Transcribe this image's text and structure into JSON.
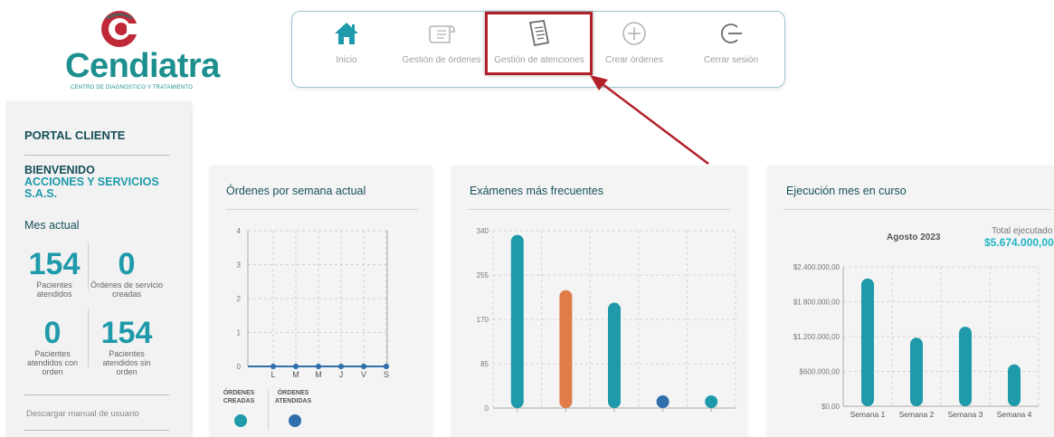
{
  "logo": {
    "name": "Cendiatra",
    "subtitle": "CENTRO DE DIAGNOSTICO Y TRATAMIENTO"
  },
  "nav": {
    "items": [
      {
        "label": "Inicio",
        "icon": "home-icon"
      },
      {
        "label": "Gestión de órdenes",
        "icon": "orders-icon"
      },
      {
        "label": "Gestión de atenciones",
        "icon": "document-icon"
      },
      {
        "label": "Crear órdenes",
        "icon": "plus-circle-icon"
      },
      {
        "label": "Cerrar sesión",
        "icon": "logout-icon"
      }
    ],
    "highlighted": "Gestión de atenciones"
  },
  "sidebar": {
    "portal": "PORTAL CLIENTE",
    "welcome_line1": "BIENVENIDO",
    "welcome_line2": "ACCIONES Y SERVICIOS S.A.S.",
    "month_label": "Mes actual",
    "stats": [
      {
        "value": "154",
        "caption": "Pacientes atendidos"
      },
      {
        "value": "0",
        "caption": "Órdenes de servicio creadas"
      },
      {
        "value": "0",
        "caption": "Pacientes atendidos con orden"
      },
      {
        "value": "154",
        "caption": "Pacientes atendidos sin orden"
      }
    ],
    "manual_link": "Descargar manual de usuario"
  },
  "colors": {
    "teal": "#1f9aaa",
    "orange": "#e07b4a",
    "blue": "#2f6fad",
    "dark_teal": "#16505a",
    "red": "#b3202a"
  },
  "cards": {
    "orders": {
      "title": "Órdenes por semana actual",
      "legend": [
        "ÓRDENES CREADAS",
        "ÓRDENES ATENDIDAS"
      ]
    },
    "exams": {
      "title": "Exámenes más frecuentes"
    },
    "execution": {
      "title": "Ejecución mes en curso",
      "period": "Agosto 2023",
      "total_label": "Total ejecutado",
      "total_value": "$5.674.000,00"
    }
  },
  "chart_data": [
    {
      "type": "line",
      "title": "Órdenes por semana actual",
      "categories": [
        "L",
        "M",
        "M",
        "J",
        "V",
        "S"
      ],
      "yticks": [
        "0",
        "1",
        "2",
        "3",
        "4"
      ],
      "ylim": [
        0,
        4
      ],
      "series": [
        {
          "name": "ÓRDENES CREADAS",
          "values": [
            0,
            0,
            0,
            0,
            0,
            0
          ]
        },
        {
          "name": "ÓRDENES ATENDIDAS",
          "values": [
            0,
            0,
            0,
            0,
            0,
            0
          ]
        }
      ],
      "grid": true
    },
    {
      "type": "bar",
      "title": "Exámenes más frecuentes",
      "values": [
        332,
        226,
        202,
        12,
        10
      ],
      "colors": [
        "#1f9aaa",
        "#e07b4a",
        "#1f9aaa",
        "#2f6fad",
        "#1f9aaa"
      ],
      "yticks": [
        "0",
        "85",
        "170",
        "255",
        "340"
      ],
      "ylim": [
        0,
        340
      ],
      "grid": true
    },
    {
      "type": "bar",
      "title": "Ejecución mes en curso",
      "categories": [
        "Semana 1",
        "Semana 2",
        "Semana 3",
        "Semana 4"
      ],
      "values": [
        2200000,
        1180000,
        1370000,
        720000
      ],
      "yticks": [
        "$0,00",
        "$600.000,00",
        "$1.200.000,00",
        "$1.800.000,00",
        "$2.400.000,00"
      ],
      "ylim": [
        0,
        2400000
      ],
      "grid": true
    }
  ]
}
